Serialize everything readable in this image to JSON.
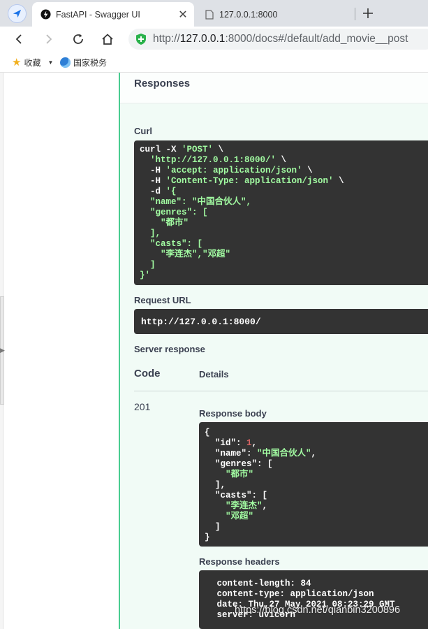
{
  "browser": {
    "active_tab_title": "FastAPI - Swagger UI",
    "inactive_tab_title": "127.0.0.1:8000",
    "url_prefix": "http://",
    "url_host": "127.0.0.1",
    "url_rest": ":8000/docs#/default/add_movie__post",
    "bookmarks": [
      {
        "label": "收藏"
      },
      {
        "label": "国家税务"
      }
    ]
  },
  "responses": {
    "heading": "Responses",
    "curl_label": "Curl",
    "curl_lines": [
      {
        "parts": [
          {
            "t": "curl -X ",
            "c": ""
          },
          {
            "t": "'POST'",
            "c": "str"
          },
          {
            "t": " \\",
            "c": ""
          }
        ]
      },
      {
        "parts": [
          {
            "t": "  'http://127.0.0.1:8000/'",
            "c": "str"
          },
          {
            "t": " \\",
            "c": ""
          }
        ]
      },
      {
        "parts": [
          {
            "t": "  -H ",
            "c": ""
          },
          {
            "t": "'accept: application/json'",
            "c": "str"
          },
          {
            "t": " \\",
            "c": ""
          }
        ]
      },
      {
        "parts": [
          {
            "t": "  -H ",
            "c": ""
          },
          {
            "t": "'Content-Type: application/json'",
            "c": "str"
          },
          {
            "t": " \\",
            "c": ""
          }
        ]
      },
      {
        "parts": [
          {
            "t": "  -d ",
            "c": ""
          },
          {
            "t": "'{",
            "c": "str"
          }
        ]
      },
      {
        "parts": [
          {
            "t": "  \"name\": \"中国合伙人\",",
            "c": "str"
          }
        ]
      },
      {
        "parts": [
          {
            "t": "  \"genres\": [",
            "c": "str"
          }
        ]
      },
      {
        "parts": [
          {
            "t": "    \"都市\"",
            "c": "str"
          }
        ]
      },
      {
        "parts": [
          {
            "t": "  ],",
            "c": "str"
          }
        ]
      },
      {
        "parts": [
          {
            "t": "  \"casts\": [",
            "c": "str"
          }
        ]
      },
      {
        "parts": [
          {
            "t": "    \"李连杰\",\"邓超\"",
            "c": "str"
          }
        ]
      },
      {
        "parts": [
          {
            "t": "  ]",
            "c": "str"
          }
        ]
      },
      {
        "parts": [
          {
            "t": "}'",
            "c": "str"
          }
        ]
      }
    ],
    "request_url_label": "Request URL",
    "request_url": "http://127.0.0.1:8000/",
    "server_response_label": "Server response",
    "col_code": "Code",
    "col_details": "Details",
    "status_code": "201",
    "response_body_label": "Response body",
    "response_body_lines": [
      {
        "parts": [
          {
            "t": "{",
            "c": ""
          }
        ]
      },
      {
        "parts": [
          {
            "t": "  \"id\"",
            "c": ""
          },
          {
            "t": ": ",
            "c": ""
          },
          {
            "t": "1",
            "c": "num"
          },
          {
            "t": ",",
            "c": ""
          }
        ]
      },
      {
        "parts": [
          {
            "t": "  \"name\"",
            "c": ""
          },
          {
            "t": ": ",
            "c": ""
          },
          {
            "t": "\"中国合伙人\"",
            "c": "str"
          },
          {
            "t": ",",
            "c": ""
          }
        ]
      },
      {
        "parts": [
          {
            "t": "  \"genres\"",
            "c": ""
          },
          {
            "t": ": [",
            "c": ""
          }
        ]
      },
      {
        "parts": [
          {
            "t": "    \"都市\"",
            "c": "str"
          }
        ]
      },
      {
        "parts": [
          {
            "t": "  ],",
            "c": ""
          }
        ]
      },
      {
        "parts": [
          {
            "t": "  \"casts\"",
            "c": ""
          },
          {
            "t": ": [",
            "c": ""
          }
        ]
      },
      {
        "parts": [
          {
            "t": "    \"李连杰\"",
            "c": "str"
          },
          {
            "t": ",",
            "c": ""
          }
        ]
      },
      {
        "parts": [
          {
            "t": "    \"邓超\"",
            "c": "str"
          }
        ]
      },
      {
        "parts": [
          {
            "t": "  ]",
            "c": ""
          }
        ]
      },
      {
        "parts": [
          {
            "t": "}",
            "c": ""
          }
        ]
      }
    ],
    "response_headers_label": "Response headers",
    "response_headers_lines": [
      " content-length: 84 ",
      " content-type: application/json ",
      " date: Thu,27 May 2021 08:23:29 GMT ",
      " server: uvicorn "
    ]
  },
  "watermark": "https://blog.csdn.net/qianbin3200896",
  "colors": {
    "post_green": "#49cc90",
    "code_bg": "#333333",
    "code_string": "#a2fca2",
    "code_number": "#d36363",
    "text": "#3b4151"
  }
}
